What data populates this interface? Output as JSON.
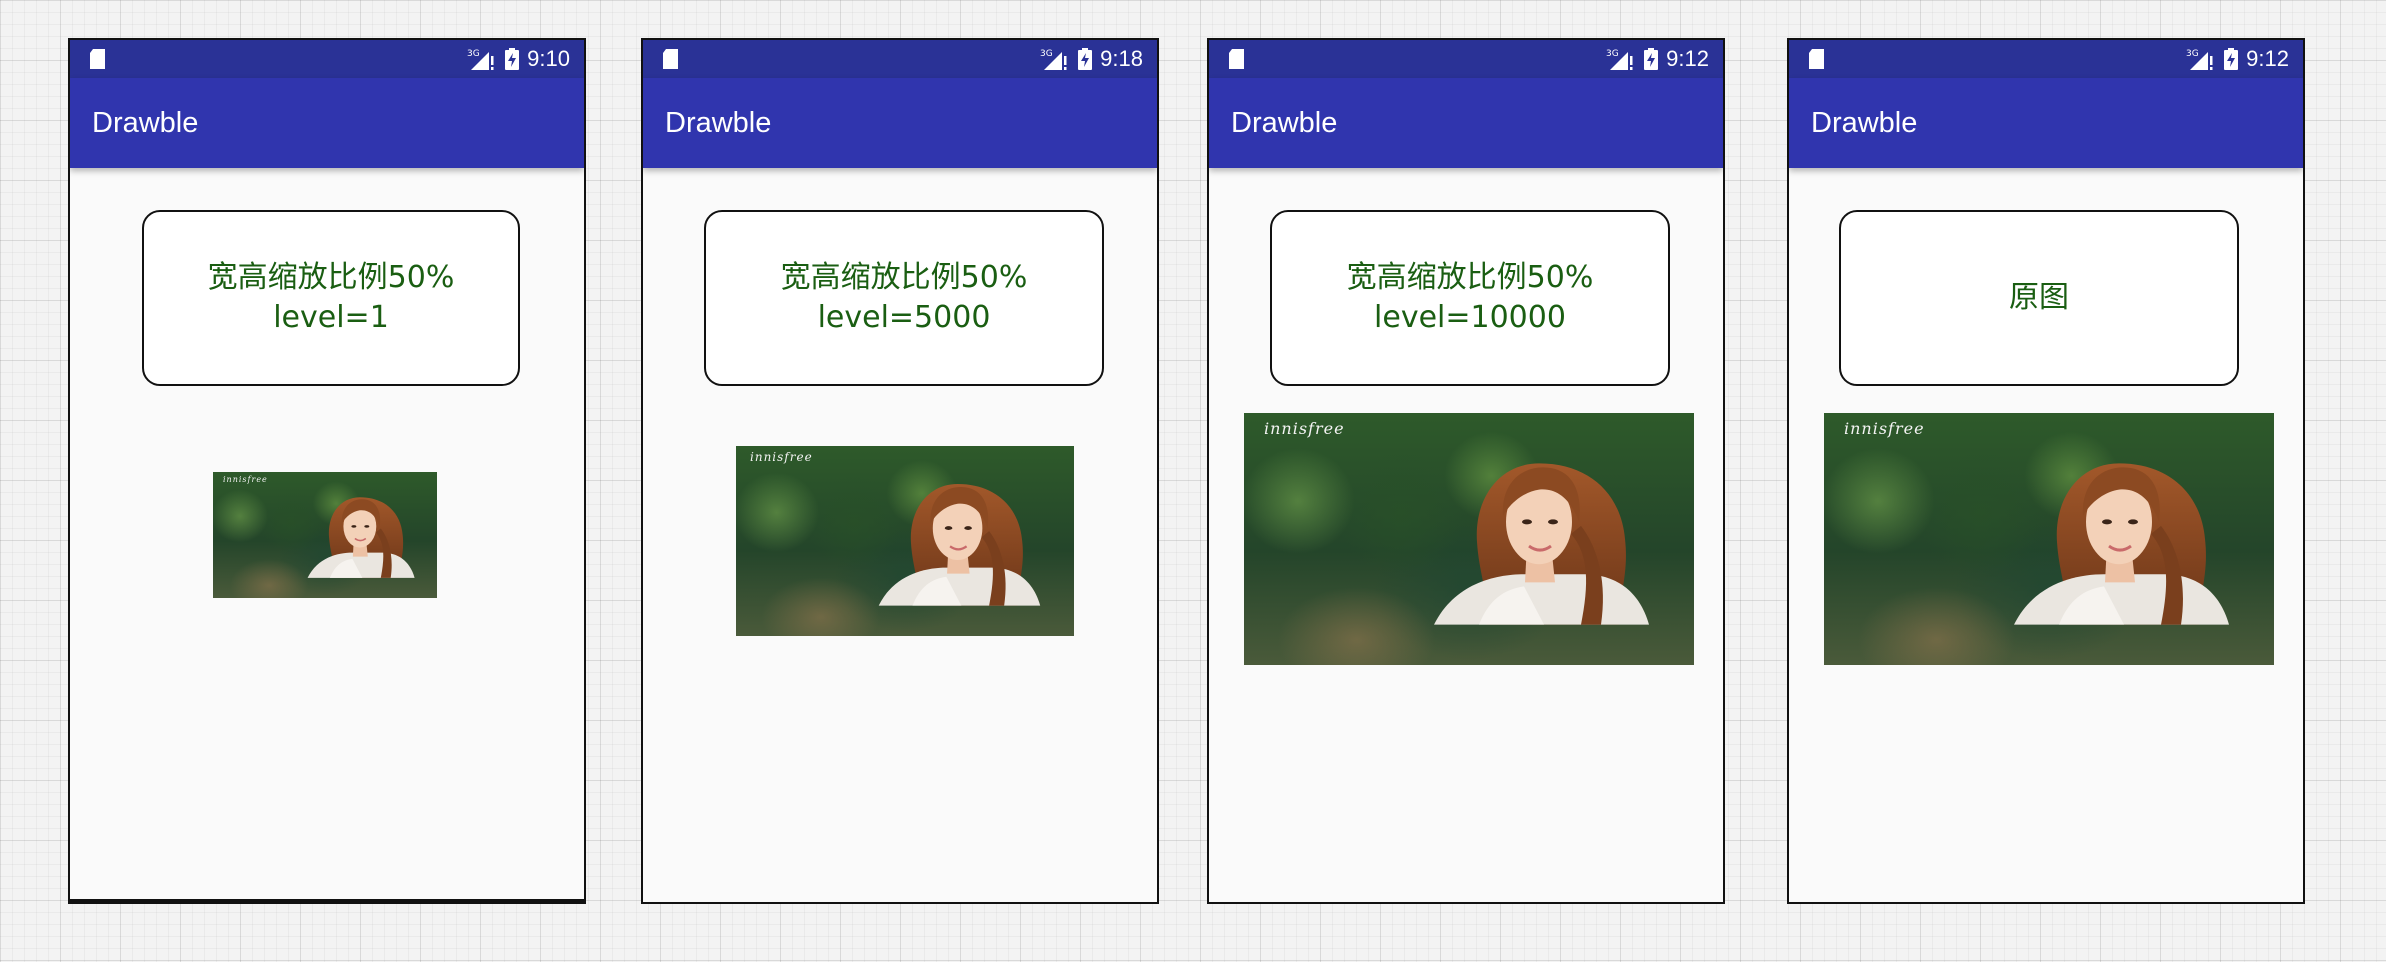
{
  "screens": [
    {
      "status": {
        "time": "9:10",
        "network": "3G"
      },
      "app_title": "Drawble",
      "label": {
        "line1": "宽高缩放比例50%",
        "line2": "level=1"
      },
      "image": {
        "watermark": "innisfree",
        "level": 1
      }
    },
    {
      "status": {
        "time": "9:18",
        "network": "3G"
      },
      "app_title": "Drawble",
      "label": {
        "line1": "宽高缩放比例50%",
        "line2": "level=5000"
      },
      "image": {
        "watermark": "innisfree",
        "level": 5000
      }
    },
    {
      "status": {
        "time": "9:12",
        "network": "3G"
      },
      "app_title": "Drawble",
      "label": {
        "line1": "宽高缩放比例50%",
        "line2": "level=10000"
      },
      "image": {
        "watermark": "innisfree",
        "level": 10000
      }
    },
    {
      "status": {
        "time": "9:12",
        "network": "3G"
      },
      "app_title": "Drawble",
      "label": {
        "line1": "原图",
        "line2": ""
      },
      "image": {
        "watermark": "innisfree"
      }
    }
  ],
  "icons": {
    "sd_card": "sd-card-icon",
    "network": "signal-3g-icon",
    "battery": "battery-charging-icon"
  },
  "colors": {
    "status_bar": "#2a3296",
    "app_bar": "#3035ae",
    "label_text": "#1a5e12",
    "screen_background": "#fafafa"
  }
}
